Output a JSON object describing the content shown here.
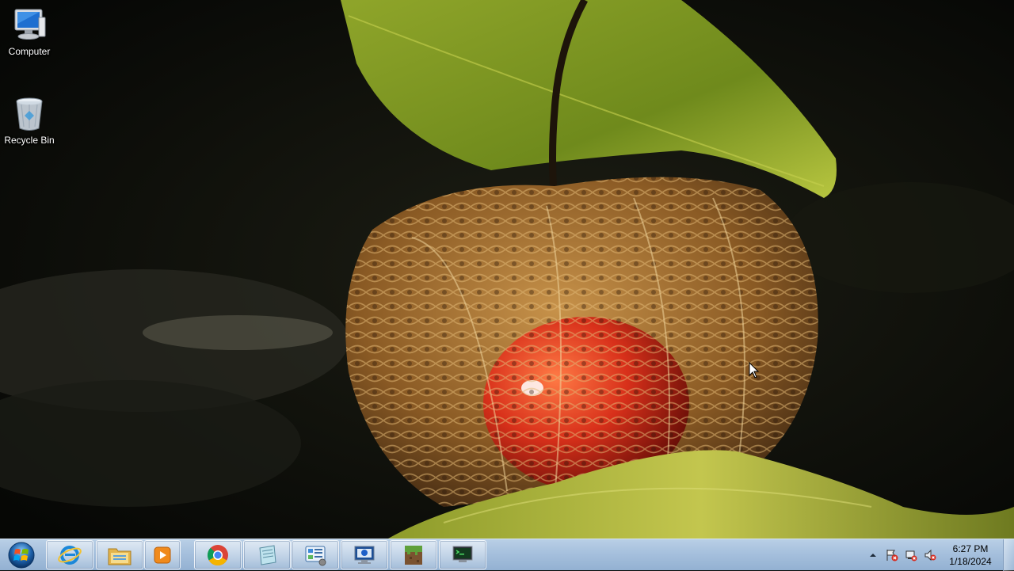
{
  "desktop": {
    "icons": [
      {
        "label": "Computer",
        "icon": "computer-icon"
      },
      {
        "label": "Recycle Bin",
        "icon": "recycle-bin-icon"
      }
    ]
  },
  "taskbar": {
    "start_button": {
      "icon": "windows-start-orb"
    },
    "pinned": [
      {
        "name": "Internet Explorer",
        "icon": "internet-explorer-icon"
      },
      {
        "name": "Windows Explorer",
        "icon": "file-explorer-folder-icon"
      },
      {
        "name": "Windows Media Player",
        "icon": "media-player-icon"
      },
      {
        "name": "Google Chrome",
        "icon": "chrome-icon"
      },
      {
        "name": "Notepad",
        "icon": "notepad-icon"
      },
      {
        "name": "Control Panel",
        "icon": "control-panel-icon"
      },
      {
        "name": "Monitor App",
        "icon": "monitor-app-icon"
      },
      {
        "name": "Minecraft",
        "icon": "minecraft-grass-block-icon"
      },
      {
        "name": "Terminal App",
        "icon": "terminal-monitor-icon"
      }
    ],
    "tray": {
      "icons": [
        "show-hidden-icons-arrow",
        "action-center-flag-error-icon",
        "network-error-icon",
        "volume-muted-icon"
      ],
      "time": "6:27 PM",
      "date": "1/18/2024"
    }
  },
  "colors": {
    "taskbar_top": "#b9cfe6",
    "taskbar_bottom": "#93b1d2",
    "wallpaper_background": "#0a0b07",
    "lantern_husk": "#9a6a2e",
    "berry_red": "#d8301a",
    "leaf_green": "#a5b83a"
  }
}
